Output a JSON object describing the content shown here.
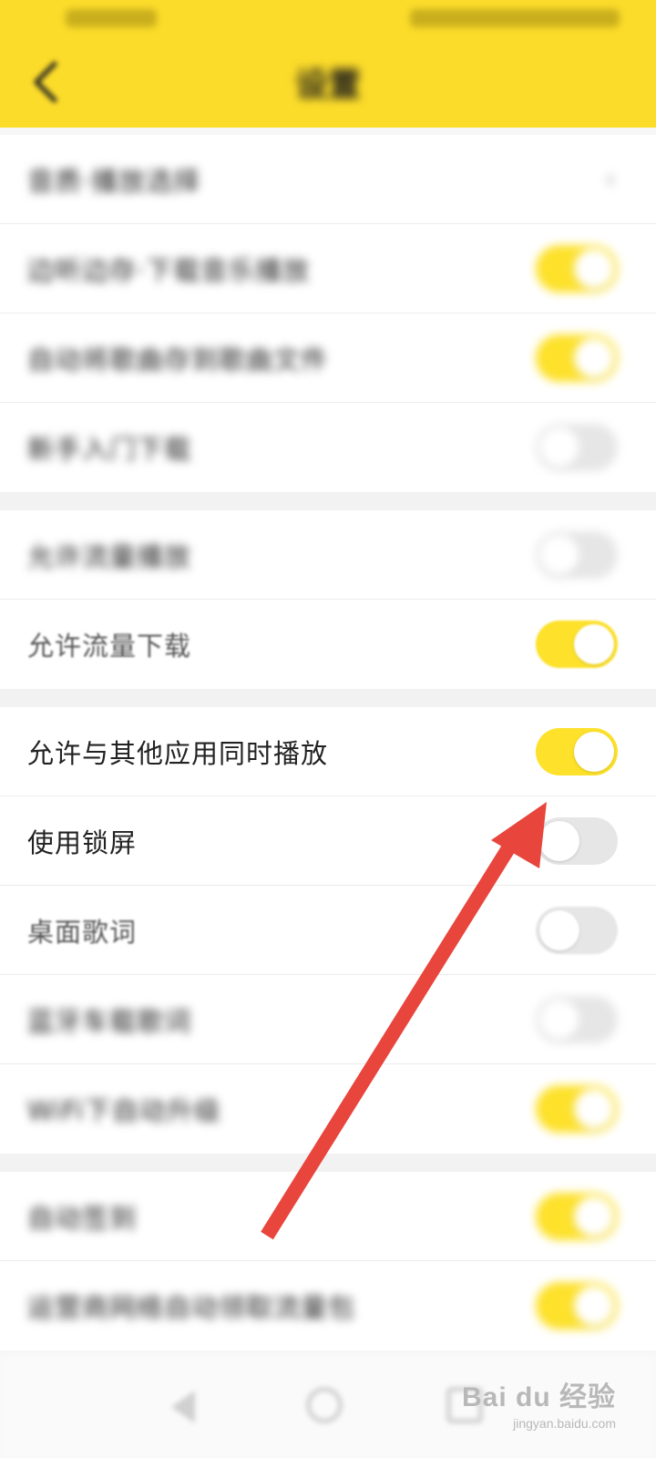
{
  "header": {
    "title": "设置",
    "status_time": "",
    "status_icons": ""
  },
  "settings": {
    "group1": [
      {
        "label": "音质·播放选择",
        "control": "chevron",
        "value": "›"
      },
      {
        "label": "边听边存·下载音乐播放",
        "control": "toggle",
        "on": true
      },
      {
        "label": "自动将歌曲存到歌曲文件",
        "control": "toggle",
        "on": true
      },
      {
        "label": "新手入门下载",
        "control": "toggle",
        "on": false
      }
    ],
    "group2": [
      {
        "label": "允许流量播放",
        "control": "toggle",
        "on": false
      },
      {
        "label": "允许流量下载",
        "control": "toggle",
        "on": true
      }
    ],
    "group3": [
      {
        "label": "允许与其他应用同时播放",
        "control": "toggle",
        "on": true
      },
      {
        "label": "使用锁屏",
        "control": "toggle",
        "on": false
      },
      {
        "label": "桌面歌词",
        "control": "toggle",
        "on": false
      },
      {
        "label": "蓝牙车载歌词",
        "control": "toggle",
        "on": false
      },
      {
        "label": "WiFi下自动升级",
        "control": "toggle",
        "on": true
      }
    ],
    "group4": [
      {
        "label": "自动签到",
        "control": "toggle",
        "on": true
      },
      {
        "label": "运营商网络自动领取流量包",
        "control": "toggle",
        "on": true
      }
    ]
  },
  "watermark": {
    "logo": "Bai du 经验",
    "url": "jingyan.baidu.com"
  },
  "colors": {
    "accent": "#fde12a",
    "header": "#fcdc2a",
    "arrow": "#e8453c"
  },
  "icons": [
    "back-arrow-icon",
    "nav-back-icon",
    "nav-home-icon",
    "nav-recent-icon"
  ]
}
